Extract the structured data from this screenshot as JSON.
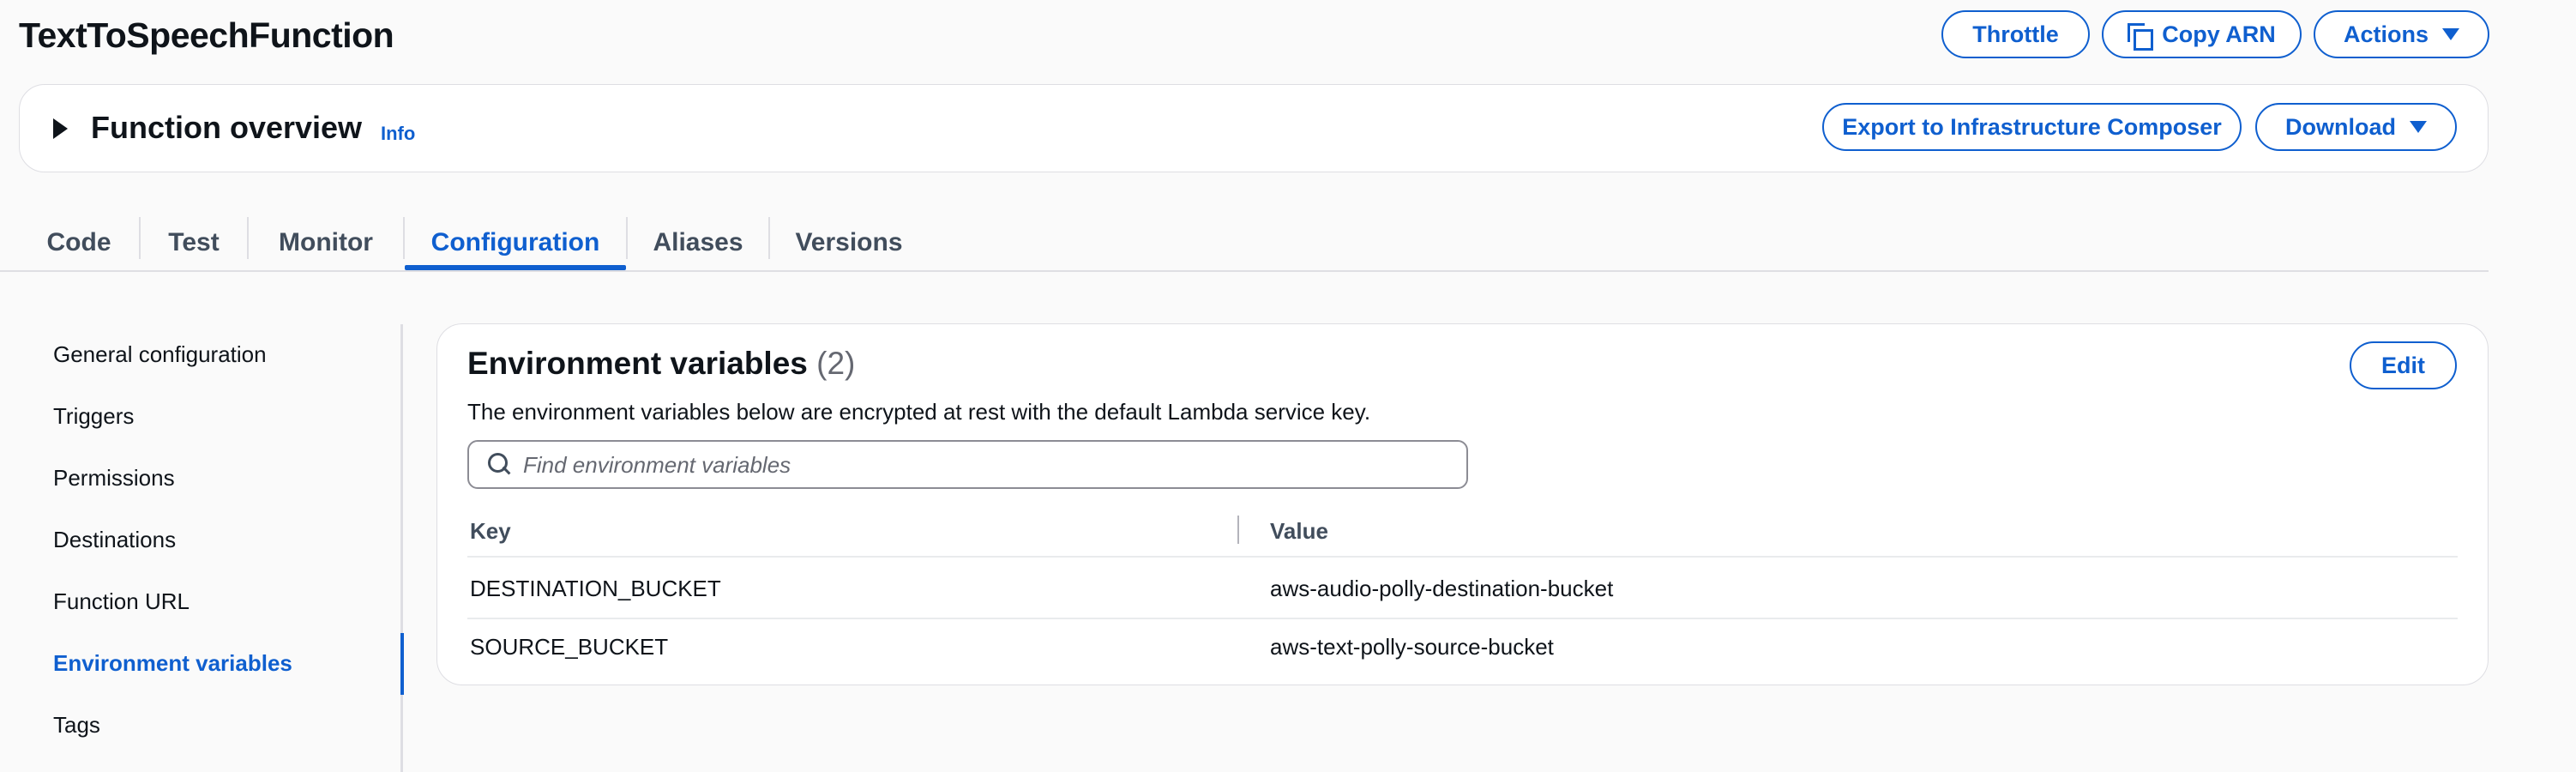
{
  "header": {
    "title": "TextToSpeechFunction",
    "throttle_label": "Throttle",
    "copy_arn_label": "Copy ARN",
    "actions_label": "Actions"
  },
  "overview": {
    "title": "Function overview",
    "info_label": "Info",
    "export_label": "Export to Infrastructure Composer",
    "download_label": "Download"
  },
  "tabs": [
    {
      "label": "Code"
    },
    {
      "label": "Test"
    },
    {
      "label": "Monitor"
    },
    {
      "label": "Configuration",
      "active": true
    },
    {
      "label": "Aliases"
    },
    {
      "label": "Versions"
    }
  ],
  "sidenav": {
    "items": [
      {
        "label": "General configuration"
      },
      {
        "label": "Triggers"
      },
      {
        "label": "Permissions"
      },
      {
        "label": "Destinations"
      },
      {
        "label": "Function URL"
      },
      {
        "label": "Environment variables",
        "active": true
      },
      {
        "label": "Tags"
      }
    ]
  },
  "env": {
    "title": "Environment variables",
    "count": "(2)",
    "edit_label": "Edit",
    "description": "The environment variables below are encrypted at rest with the default Lambda service key.",
    "search_placeholder": "Find environment variables",
    "columns": {
      "key": "Key",
      "value": "Value"
    },
    "rows": [
      {
        "key": "DESTINATION_BUCKET",
        "value": "aws-audio-polly-destination-bucket"
      },
      {
        "key": "SOURCE_BUCKET",
        "value": "aws-text-polly-source-bucket"
      }
    ]
  },
  "colors": {
    "accent": "#0f5fcf",
    "text": "#0f141a",
    "muted": "#414d5c",
    "border": "#dedee3",
    "background": "#fafafa"
  },
  "icons": [
    "play-toggle-icon",
    "copy-icon",
    "caret-down-icon",
    "search-icon"
  ]
}
